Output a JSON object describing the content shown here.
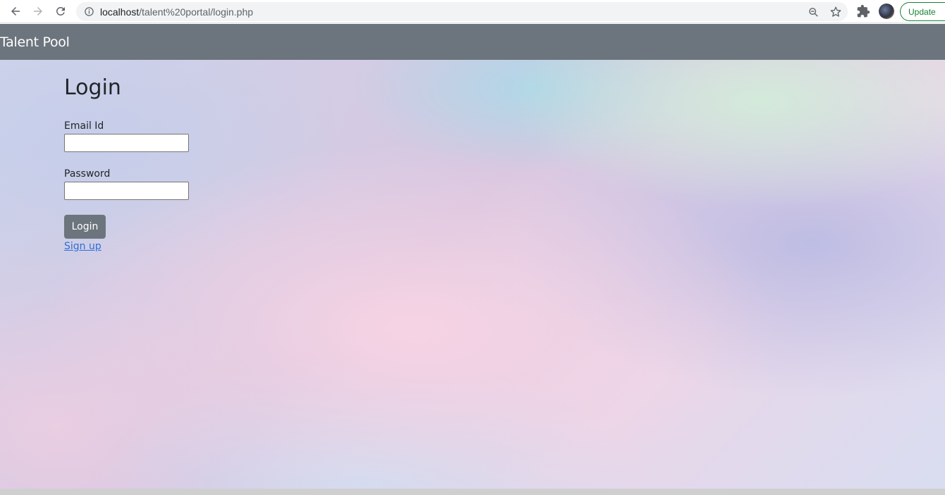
{
  "browser": {
    "url_host": "localhost",
    "url_path": "/talent%20portal/login.php",
    "update_label": "Update",
    "icons": [
      "back-icon",
      "forward-icon",
      "reload-icon",
      "info-icon",
      "zoom-icon",
      "star-icon",
      "extensions-icon"
    ]
  },
  "navbar": {
    "brand": "Talent Pool",
    "color": "#6c757d"
  },
  "form": {
    "title": "Login",
    "email_label": "Email Id",
    "email_value": "",
    "password_label": "Password",
    "password_value": "",
    "submit_label": "Login",
    "signup_label": "Sign up"
  },
  "colors": {
    "link": "#2f6fd6",
    "update_green": "#188038"
  }
}
